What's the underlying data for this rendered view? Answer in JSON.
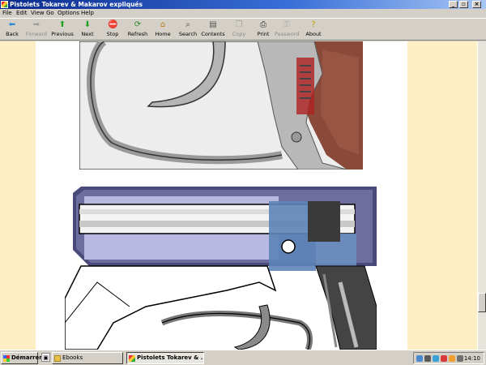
{
  "window": {
    "title": "Pistolets Tokarev & Makarov expliqués"
  },
  "menu": [
    "File",
    "Edit",
    "View",
    "Go",
    "Options",
    "Help"
  ],
  "toolbar": {
    "items": [
      {
        "label": "Back",
        "icon": "back-arrow-icon",
        "enabled": true
      },
      {
        "label": "Forward",
        "icon": "forward-arrow-icon",
        "enabled": false
      },
      {
        "label": "Previous",
        "icon": "up-arrow-icon",
        "enabled": true
      },
      {
        "label": "Next",
        "icon": "down-arrow-icon",
        "enabled": true
      },
      {
        "label": "Stop",
        "icon": "stop-icon",
        "enabled": true
      },
      {
        "label": "Refresh",
        "icon": "refresh-icon",
        "enabled": true
      },
      {
        "label": "Home",
        "icon": "home-icon",
        "enabled": true
      },
      {
        "label": "Search",
        "icon": "search-icon",
        "enabled": true
      },
      {
        "label": "Contents",
        "icon": "contents-icon",
        "enabled": true
      },
      {
        "label": "Copy",
        "icon": "copy-icon",
        "enabled": false
      },
      {
        "label": "Print",
        "icon": "print-icon",
        "enabled": true
      },
      {
        "label": "Password",
        "icon": "password-icon",
        "enabled": false
      },
      {
        "label": "About",
        "icon": "about-icon",
        "enabled": true
      }
    ]
  },
  "content": {
    "page_background": "#fdeec4",
    "figures": [
      {
        "name": "trigger-guard-photo",
        "description_icon": "photo-icon"
      },
      {
        "name": "pistol-cutaway-diagram",
        "description_icon": "diagram-icon"
      }
    ]
  },
  "taskbar": {
    "start_label": "Démarrer",
    "tasks": [
      {
        "label": "Ebooks",
        "active": false
      },
      {
        "label": "Pistolets Tokarev & ...",
        "active": true
      }
    ],
    "clock": "14:10"
  }
}
